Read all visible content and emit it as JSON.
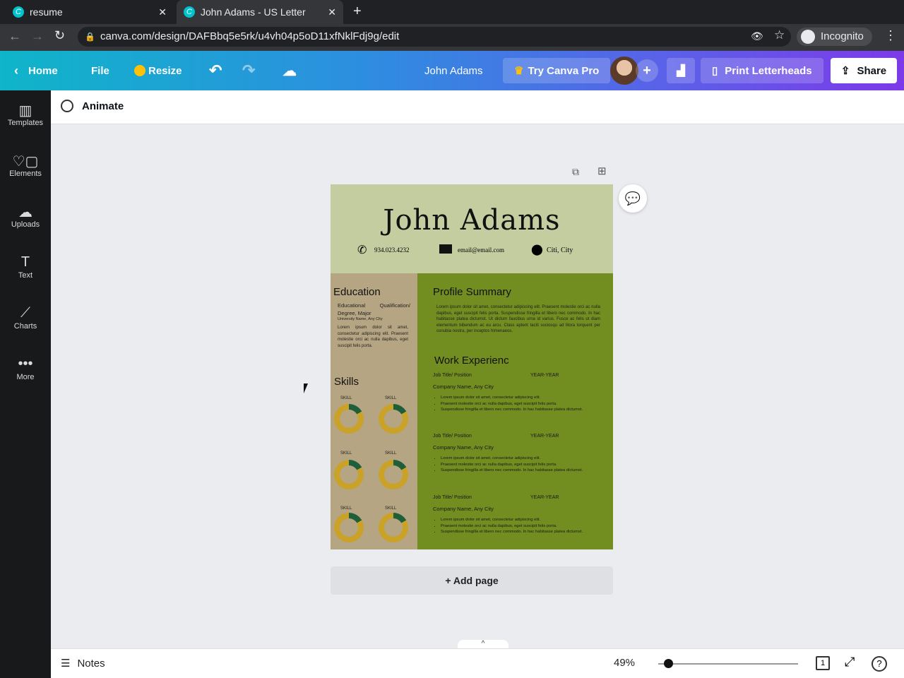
{
  "browser": {
    "tabs": [
      {
        "title": "resume",
        "active": false
      },
      {
        "title": "John Adams - US Letter",
        "active": true
      }
    ],
    "url": "canva.com/design/DAFBbq5e5rk/u4vh04p5oD11xfNklFdj9g/edit",
    "profile": "Incognito"
  },
  "header": {
    "home": "Home",
    "file": "File",
    "resize": "Resize",
    "doc_title": "John Adams",
    "try_pro": "Try Canva Pro",
    "print": "Print Letterheads",
    "share": "Share"
  },
  "sidebar": {
    "items": [
      {
        "label": "Templates"
      },
      {
        "label": "Elements"
      },
      {
        "label": "Uploads"
      },
      {
        "label": "Text"
      },
      {
        "label": "Charts"
      },
      {
        "label": "More"
      }
    ]
  },
  "toolbar": {
    "animate": "Animate"
  },
  "resume": {
    "name": "John Adams",
    "phone": "934.023.4232",
    "email": "email@email.com",
    "location": "Citi, City",
    "education": {
      "heading": "Education",
      "qualification": "Educational Qualification/ Degree, Major",
      "university": "University Name, Any City",
      "text": "Lorem ipsum dolor sit amet, consectetur adipiscing elit. Praesent molestie orci ac nulla dapibus, eget suscipit felis porta."
    },
    "skills": {
      "heading": "Skills",
      "items": [
        "SKILL",
        "SKILL",
        "SKILL",
        "SKILL",
        "SKILL",
        "SKILL"
      ]
    },
    "profile": {
      "heading": "Profile Summary",
      "text": "Lorem ipsum dolor sit amet, consectetur adipiscing elit. Praesent molestie orci ac nulla dapibus, eget suscipit felis porta. Suspendisse fringilla et libero nec commodo. In hac habitasse platea dictumst. Ut dictum faucibus urna id varius. Fusce ac felis ut diam elementum bibendum ac eu arcu. Class aptent taciti sociosqu ad litora torquent per conubia nostra, per inceptos himenaeos."
    },
    "work": {
      "heading": "Work Experienc",
      "jobs": [
        {
          "title": "Job Title/ Position",
          "years": "YEAR-YEAR",
          "company": "Company Name, Any City",
          "bullets": [
            "Lorem ipsum dolor sit amet, consectetur adipiscing elit.",
            "Praesent molestie orci ac nulla dapibus, eget suscipit felis porta.",
            "Suspendisse fringilla et libero nec commodo. In hac habitasse platea dictumst."
          ]
        },
        {
          "title": "Job Title/ Position",
          "years": "YEAR-YEAR",
          "company": "Company Name, Any City",
          "bullets": [
            "Lorem ipsum dolor sit amet, consectetur adipiscing elit.",
            "Praesent molestie orci ac nulla dapibus, eget suscipit felis porta.",
            "Suspendisse fringilla et libero nec commodo. In hac habitasse platea dictumst."
          ]
        },
        {
          "title": "Job Title/ Position",
          "years": "YEAR-YEAR",
          "company": "Company Name, Any City",
          "bullets": [
            "Lorem ipsum dolor sit amet, consectetur adipiscing elit.",
            "Praesent molestie orci ac nulla dapibus, eget suscipit felis porta.",
            "Suspendisse fringilla et libero nec commodo. In hac habitasse platea dictumst."
          ]
        }
      ]
    }
  },
  "canvas": {
    "add_page": "+ Add page"
  },
  "footer": {
    "notes": "Notes",
    "zoom": "49%",
    "zoom_fraction": 0.07,
    "page_count": "1"
  }
}
